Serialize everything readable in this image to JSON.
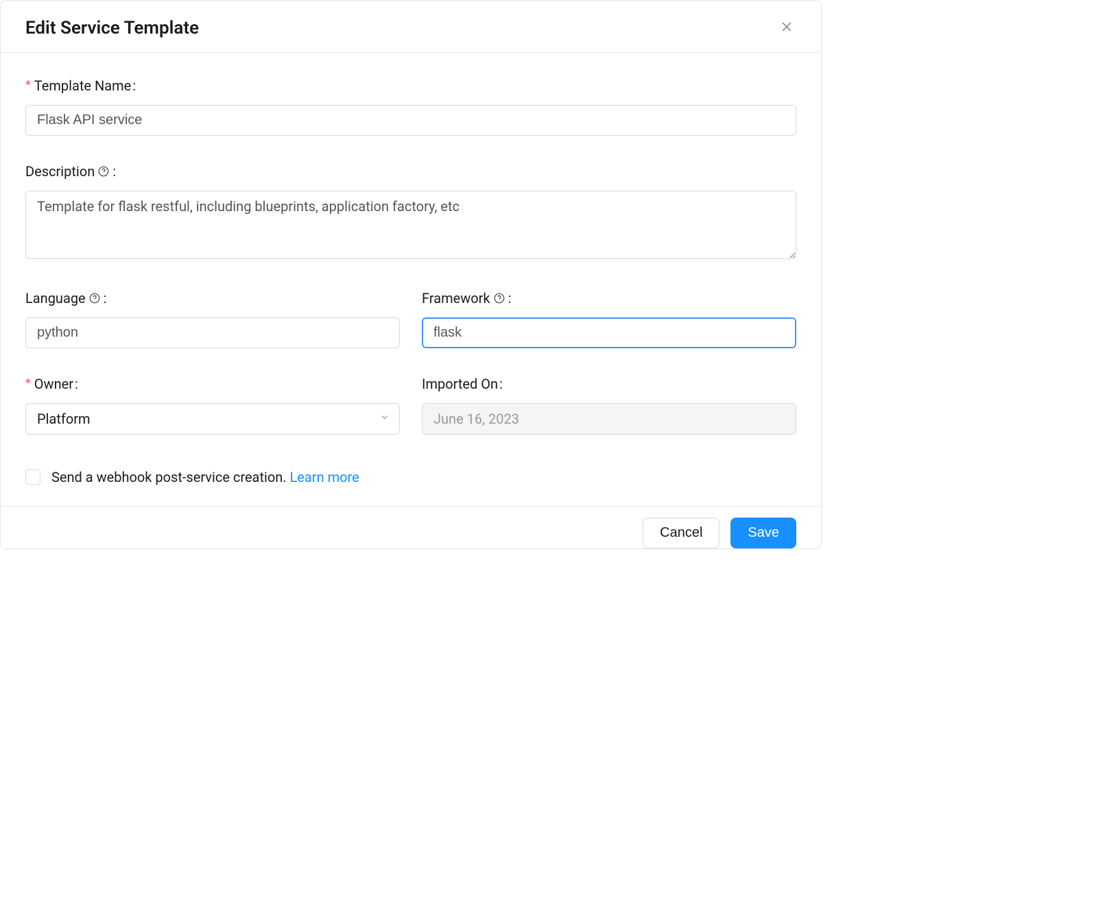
{
  "modal": {
    "title": "Edit Service Template"
  },
  "form": {
    "template_name": {
      "label": "Template Name",
      "value": "Flask API service",
      "required": true
    },
    "description": {
      "label": "Description",
      "value": "Template for flask restful, including blueprints, application factory, etc"
    },
    "language": {
      "label": "Language",
      "value": "python"
    },
    "framework": {
      "label": "Framework",
      "value": "flask"
    },
    "owner": {
      "label": "Owner",
      "value": "Platform",
      "required": true
    },
    "imported_on": {
      "label": "Imported On",
      "value": "June 16, 2023"
    },
    "webhook": {
      "label": "Send a webhook post-service creation. ",
      "learn_more": "Learn more"
    }
  },
  "footer": {
    "cancel": "Cancel",
    "save": "Save"
  }
}
